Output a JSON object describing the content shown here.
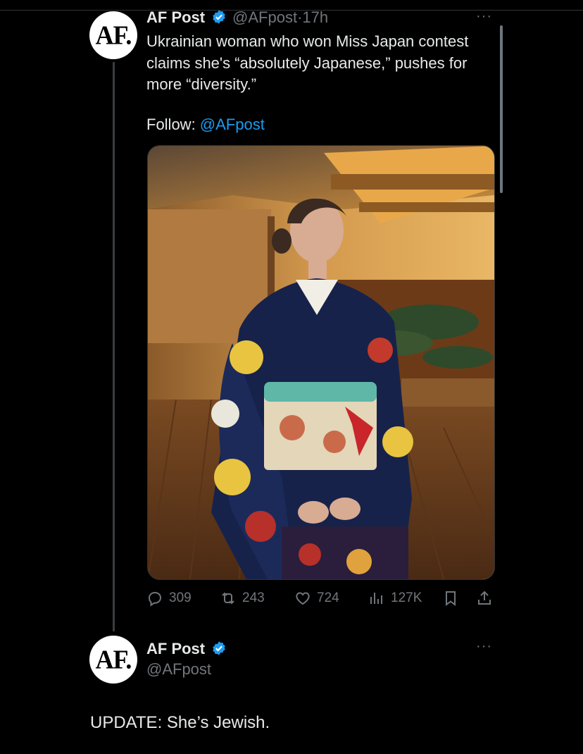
{
  "tweet1": {
    "avatar_text": "AF.",
    "name": "AF Post",
    "handle": "@AFpost",
    "separator": "·",
    "time": "17h",
    "more": "···",
    "text_line1": "Ukrainian woman who won Miss Japan contest",
    "text_line2": "claims she's “absolutely Japanese,” pushes for",
    "text_line3": "more “diversity.”",
    "follow_label": "Follow: ",
    "follow_handle": "@AFpost",
    "stats": {
      "replies": "309",
      "reposts": "243",
      "likes": "724",
      "views": "127K"
    }
  },
  "tweet2": {
    "avatar_text": "AF.",
    "name": "AF Post",
    "handle": "@AFpost",
    "more": "···",
    "text": "UPDATE: She’s Jewish."
  },
  "colors": {
    "background": "#000000",
    "text": "#e7e9ea",
    "muted": "#71767b",
    "link": "#1d9bf0",
    "verified": "#1d9bf0"
  },
  "icons": [
    "verified-badge-icon",
    "more-icon",
    "reply-icon",
    "repost-icon",
    "like-icon",
    "views-icon",
    "bookmark-icon",
    "share-icon"
  ]
}
